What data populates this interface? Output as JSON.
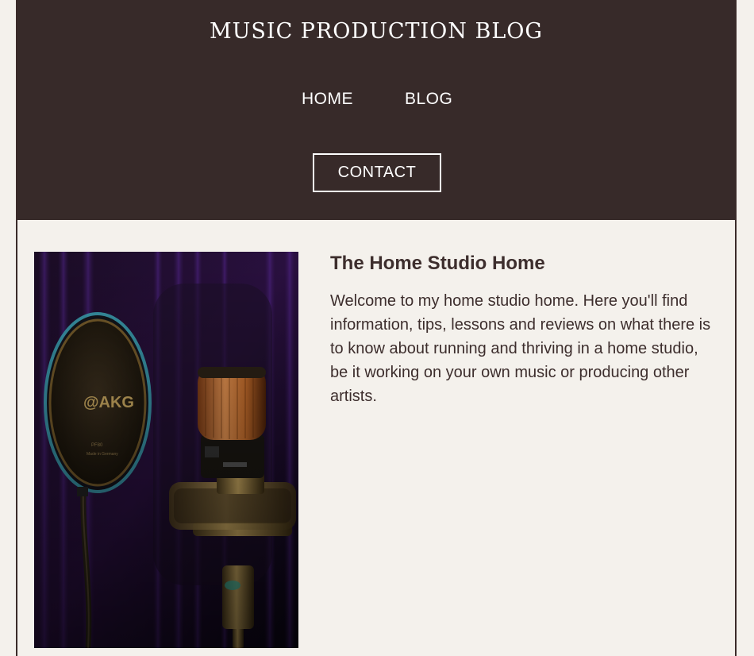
{
  "header": {
    "site_title": "MUSIC PRODUCTION BLOG",
    "nav": {
      "home": "HOME",
      "blog": "BLOG",
      "contact": "CONTACT"
    },
    "background_color": "#372a29"
  },
  "main": {
    "post_title": "The Home Studio Home",
    "post_body": "Welcome to my home studio home. Here you'll find information, tips, lessons and reviews on what there is to know about running and thriving in a home studio, be it working on your own music or producing other artists.",
    "image": {
      "icon": "studio-microphone-photo",
      "pop_filter_brand": "AKG"
    }
  },
  "colors": {
    "page_bg": "#f4f1ec",
    "text": "#3d2e2d",
    "header_text": "#ffffff"
  }
}
